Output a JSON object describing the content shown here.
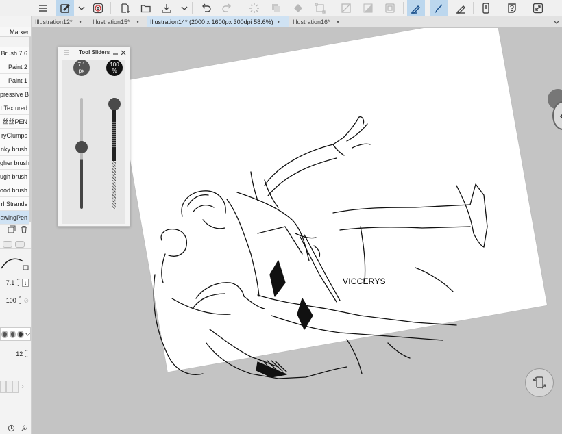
{
  "toolbar": {
    "icons": [
      "menu-icon",
      "layer-mode-icon",
      "chevron-down-icon",
      "spiral-icon",
      "new-file-icon",
      "open-folder-icon",
      "save-cloud-icon",
      "chevron-down-icon",
      "undo-icon",
      "redo-icon",
      "loading-icon",
      "layer-copy-icon",
      "fill-icon",
      "transform-icon",
      "clear-icon",
      "tone-icon",
      "crop-icon",
      "pen-active-icon",
      "brush-active-icon",
      "pen-icon",
      "device-icon",
      "help-icon",
      "expand-icon"
    ]
  },
  "tabs": [
    {
      "label": "Illustration12*",
      "dot": "•",
      "active": false
    },
    {
      "label": "Illustration15*",
      "dot": "•",
      "active": false
    },
    {
      "label": "Illustration14* (2000 x 1600px 300dpi 58.6%)",
      "dot": "•",
      "active": true
    },
    {
      "label": "Illustration16*",
      "dot": "•",
      "active": false
    }
  ],
  "brush_panel": {
    "header": "Marker",
    "items": [
      {
        "label": "Brush 7 6",
        "selected": false
      },
      {
        "label": "Paint 2",
        "selected": false
      },
      {
        "label": "Paint 1",
        "selected": false
      },
      {
        "label": "pressive B",
        "selected": false
      },
      {
        "label": "t Textured",
        "selected": false
      },
      {
        "label": "丝丝PEN",
        "selected": false
      },
      {
        "label": "ryClumps",
        "selected": false
      },
      {
        "label": "nky brush",
        "selected": false
      },
      {
        "label": "gher brush",
        "selected": false
      },
      {
        "label": "ugh brush",
        "selected": false
      },
      {
        "label": "ood brush",
        "selected": false
      },
      {
        "label": "rl Strands",
        "selected": false
      },
      {
        "label": "awingPen",
        "selected": true
      }
    ],
    "size_value": "7.1",
    "opacity_value": "100",
    "stabilization_value": "12"
  },
  "tool_sliders": {
    "title": "Tool Sliders",
    "brush_size": {
      "value": "7.1",
      "unit": "px",
      "level": 0.56
    },
    "opacity": {
      "value": "100",
      "unit": "%",
      "level": 1.0
    }
  },
  "canvas": {
    "text": "VICCERYS"
  },
  "colors": {
    "active_tab": "#cfe2f3",
    "active_tool": "#bcd7ee",
    "canvas_bg": "#c4c4c4"
  }
}
